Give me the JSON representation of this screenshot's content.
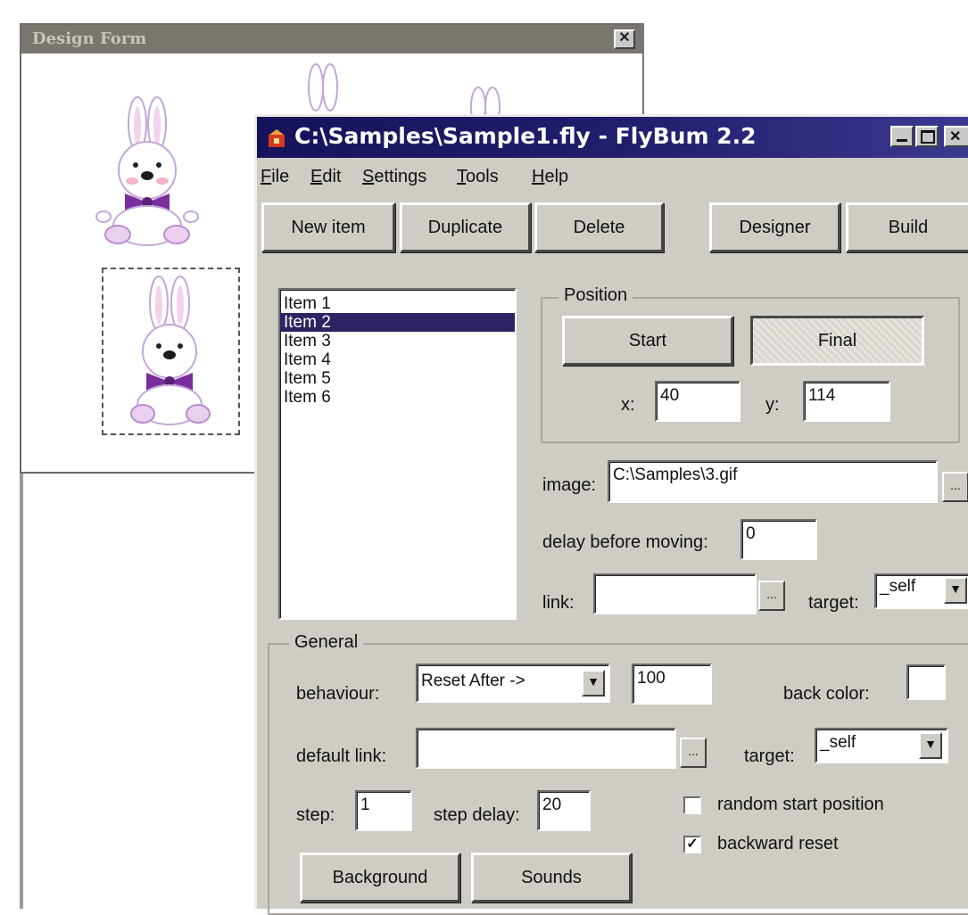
{
  "design_form": {
    "title": "Design Form",
    "close_glyph": "✕"
  },
  "main_window": {
    "title": "C:\\Samples\\Sample1.fly - FlyBum 2.2",
    "icon": "app-icon",
    "window_buttons": [
      "minimize-icon",
      "maximize-icon",
      "close-icon"
    ]
  },
  "menu": [
    {
      "accel": "F",
      "rest": "ile"
    },
    {
      "accel": "E",
      "rest": "dit"
    },
    {
      "accel": "S",
      "rest": "ettings"
    },
    {
      "accel": "T",
      "rest": "ools"
    },
    {
      "accel": "H",
      "rest": "elp"
    }
  ],
  "toolbar": {
    "new_item": "New item",
    "duplicate": "Duplicate",
    "delete": "Delete",
    "designer": "Designer",
    "build": "Build"
  },
  "items": [
    "Item 1",
    "Item 2",
    "Item 3",
    "Item 4",
    "Item 5",
    "Item 6"
  ],
  "selected_item": "Item 2",
  "position": {
    "group_label": "Position",
    "start": "Start",
    "final": "Final",
    "x_label": "x:",
    "x_value": "40",
    "y_label": "y:",
    "y_value": "114"
  },
  "image": {
    "label": "image:",
    "value": "C:\\Samples\\3.gif",
    "browse": "..."
  },
  "delay": {
    "label": "delay before moving:",
    "value": "0"
  },
  "link": {
    "label": "link:",
    "value": "",
    "browse": "...",
    "target_label": "target:",
    "target_value": "_self"
  },
  "general": {
    "group_label": "General",
    "behaviour_label": "behaviour:",
    "behaviour_value": "Reset After ->",
    "behaviour_number": "100",
    "back_color_label": "back color:",
    "back_color": "#ffffff",
    "default_link_label": "default link:",
    "default_link_value": "",
    "default_link_browse": "...",
    "target_label": "target:",
    "target_value": "_self",
    "step_label": "step:",
    "step_value": "1",
    "step_delay_label": "step delay:",
    "step_delay_value": "20",
    "random_start_label": "random start position",
    "random_start_checked": false,
    "backward_reset_label": "backward reset",
    "backward_reset_checked": true,
    "check_glyph": "✓",
    "background_button": "Background",
    "sounds_button": "Sounds"
  },
  "dropdown_glyph": "▼",
  "colors": {
    "title_bar": "#1d1a63",
    "selection": "#2c2462",
    "bunny_bow": "#7a2d9c",
    "face": "#c0c0c0"
  }
}
